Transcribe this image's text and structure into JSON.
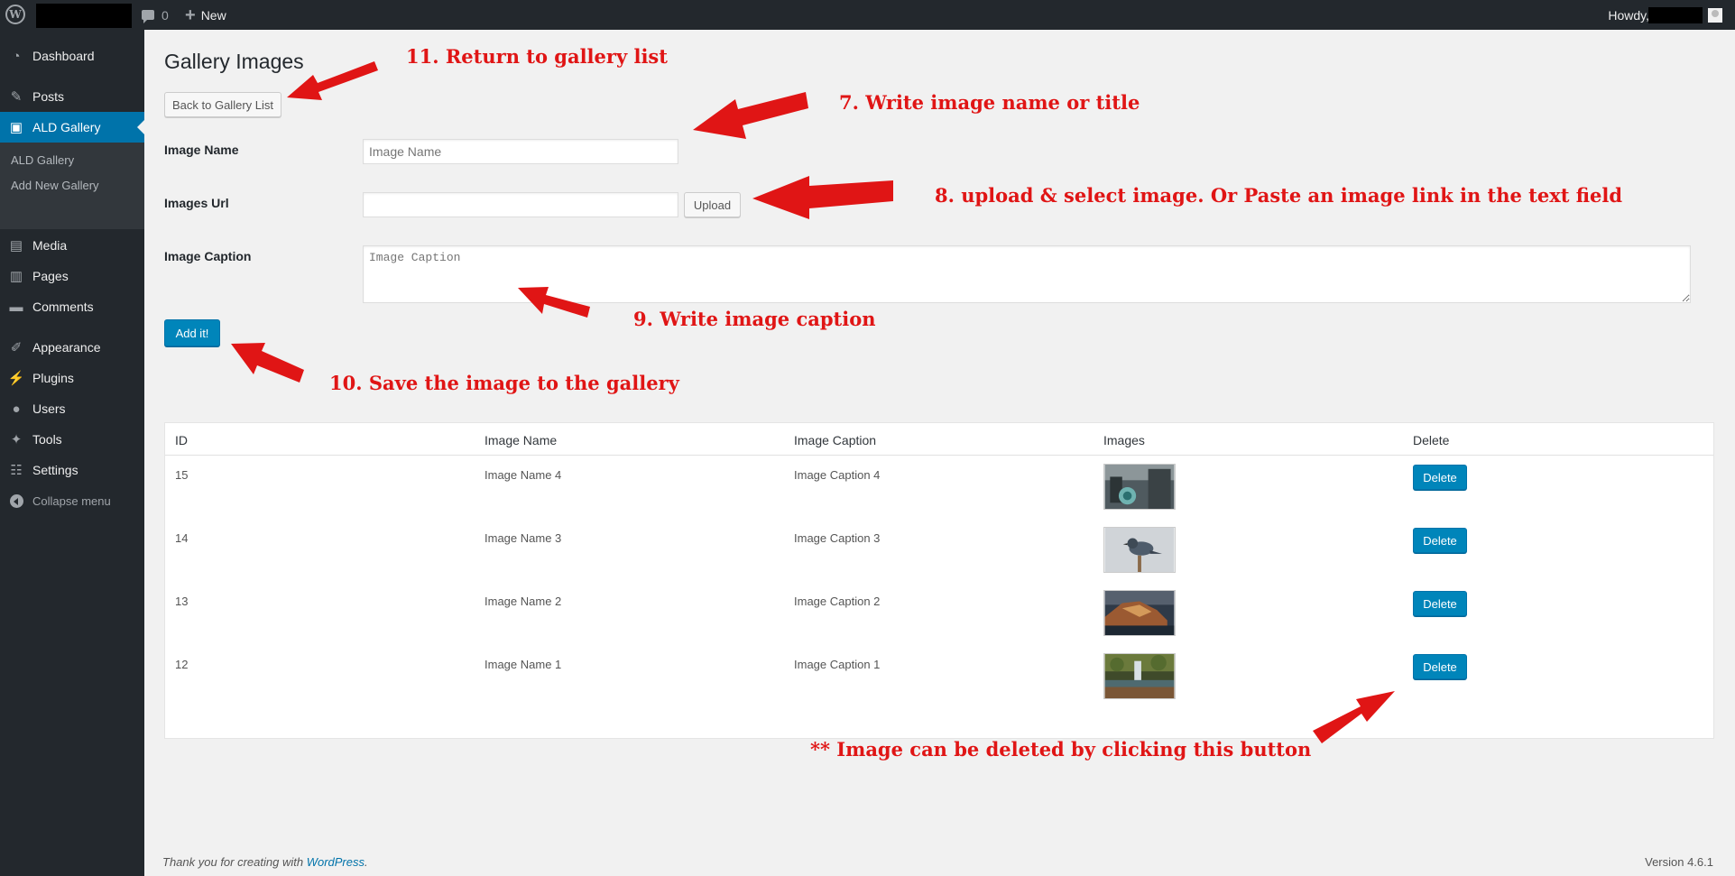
{
  "adminbar": {
    "comment_count": "0",
    "new_label": "New",
    "howdy": "Howdy,"
  },
  "sidebar": {
    "items": [
      {
        "label": "Dashboard",
        "icon": "dashboard-icon"
      },
      {
        "label": "Posts",
        "icon": "pin-icon"
      },
      {
        "label": "ALD Gallery",
        "icon": "gallery-icon"
      },
      {
        "label": "Media",
        "icon": "media-icon"
      },
      {
        "label": "Pages",
        "icon": "pages-icon"
      },
      {
        "label": "Comments",
        "icon": "comments-icon"
      },
      {
        "label": "Appearance",
        "icon": "brush-icon"
      },
      {
        "label": "Plugins",
        "icon": "plug-icon"
      },
      {
        "label": "Users",
        "icon": "user-icon"
      },
      {
        "label": "Tools",
        "icon": "wrench-icon"
      },
      {
        "label": "Settings",
        "icon": "sliders-icon"
      }
    ],
    "submenu": [
      "ALD Gallery",
      "Add New Gallery"
    ],
    "collapse": "Collapse menu"
  },
  "page": {
    "title": "Gallery Images",
    "back_button": "Back to Gallery List",
    "image_name_label": "Image Name",
    "image_name_placeholder": "Image Name",
    "image_url_label": "Images Url",
    "image_url_value": "",
    "upload_button": "Upload",
    "caption_label": "Image Caption",
    "caption_placeholder": "Image Caption",
    "add_button": "Add it!"
  },
  "table": {
    "headers": [
      "ID",
      "Image Name",
      "Image Caption",
      "Images",
      "Delete"
    ],
    "rows": [
      {
        "id": "15",
        "name": "Image Name 4",
        "caption": "Image Caption 4",
        "image": "city-street-photo",
        "delete": "Delete"
      },
      {
        "id": "14",
        "name": "Image Name 3",
        "caption": "Image Caption 3",
        "image": "bird-photo",
        "delete": "Delete"
      },
      {
        "id": "13",
        "name": "Image Name 2",
        "caption": "Image Caption 2",
        "image": "cliff-village-photo",
        "delete": "Delete"
      },
      {
        "id": "12",
        "name": "Image Name 1",
        "caption": "Image Caption 1",
        "image": "waterfall-photo",
        "delete": "Delete"
      }
    ]
  },
  "footer": {
    "thanks_prefix": "Thank you for creating with ",
    "wordpress_link": "WordPress",
    "thanks_suffix": ".",
    "version": "Version 4.6.1"
  },
  "annotations": {
    "a11": "11. Return to gallery list",
    "a7": "7. Write image name or title",
    "a8": "8. upload & select image. Or Paste an image link in the text field",
    "a9": "9. Write image caption",
    "a10": "10. Save the image to the gallery",
    "adel": "** Image can be deleted by clicking this button",
    "color": "#e01515"
  }
}
